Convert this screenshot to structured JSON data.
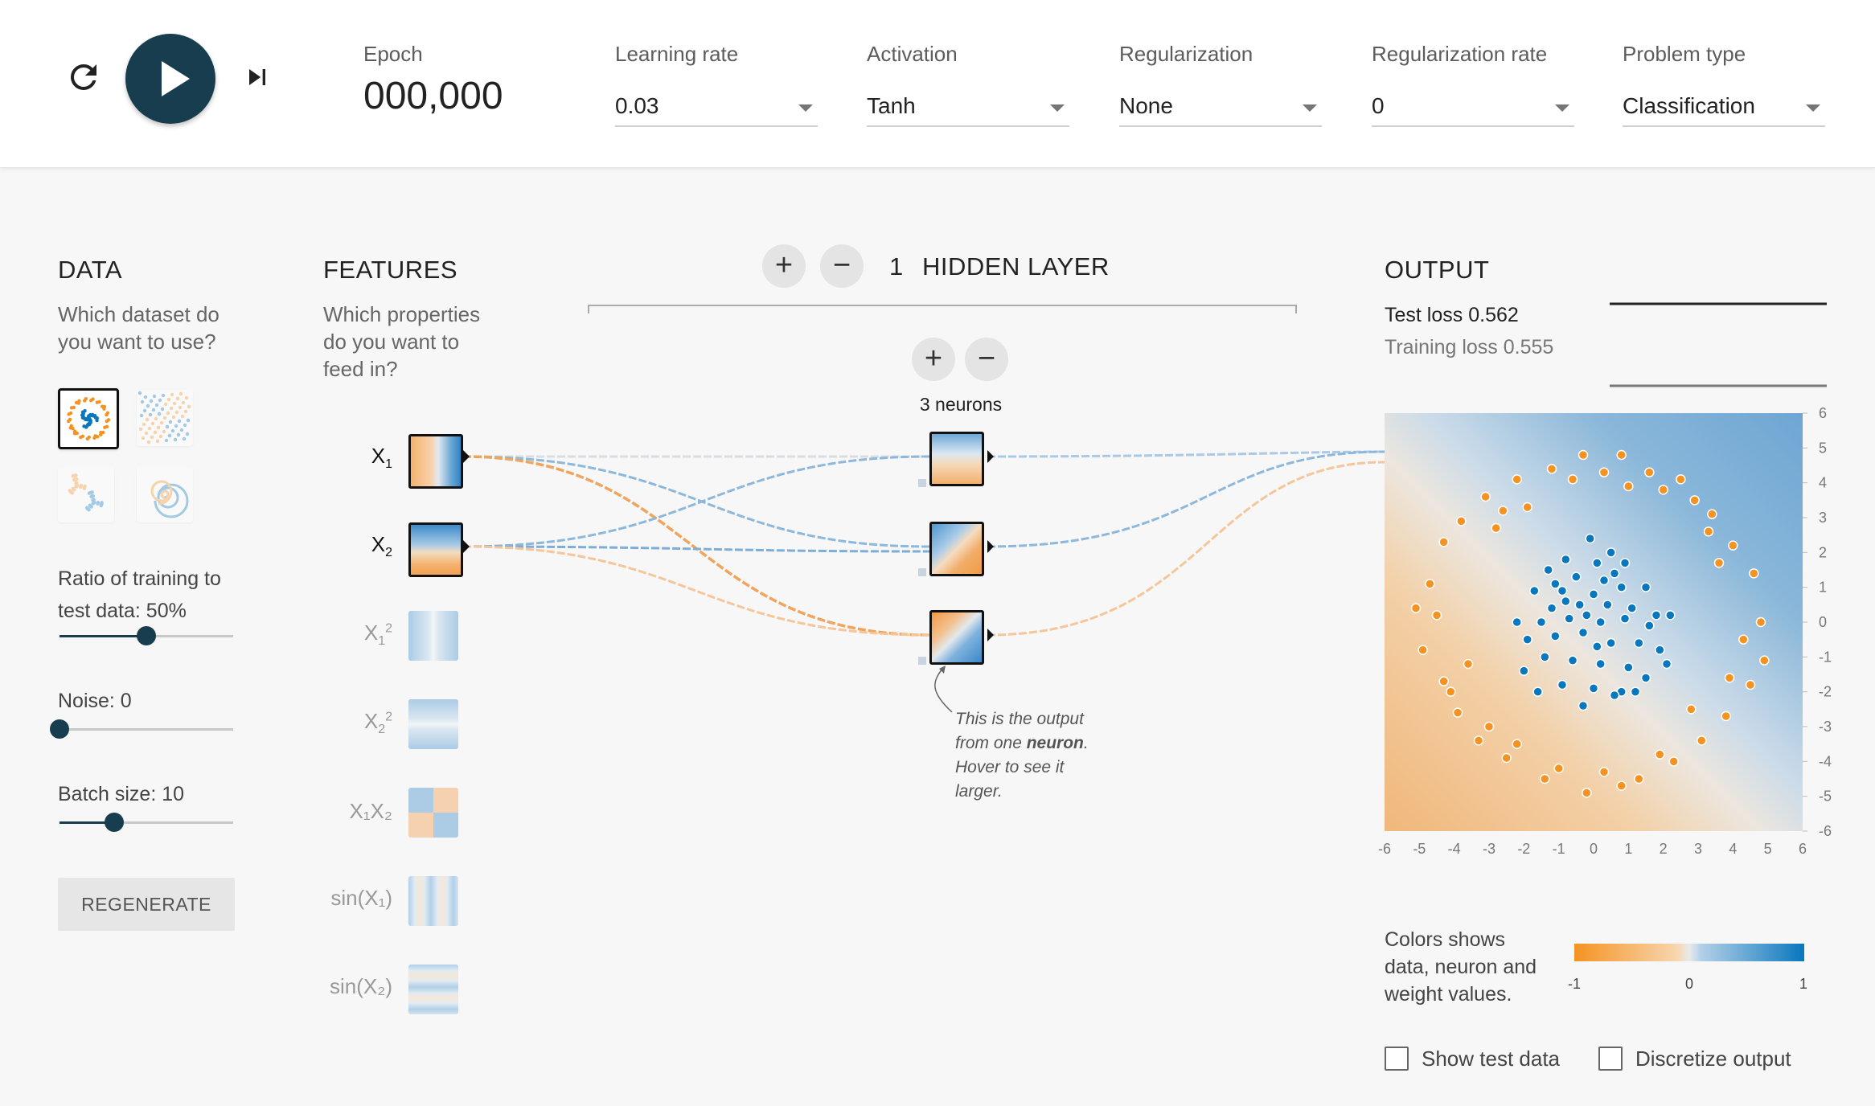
{
  "toolbar": {
    "epoch_label": "Epoch",
    "epoch_value": "000,000",
    "controls": [
      {
        "label": "Learning rate",
        "value": "0.03"
      },
      {
        "label": "Activation",
        "value": "Tanh"
      },
      {
        "label": "Regularization",
        "value": "None"
      },
      {
        "label": "Regularization rate",
        "value": "0"
      },
      {
        "label": "Problem type",
        "value": "Classification"
      }
    ]
  },
  "data_panel": {
    "heading": "DATA",
    "question_line1": "Which dataset do",
    "question_line2": "you want to use?",
    "datasets": [
      "circle",
      "xor",
      "gaussian",
      "spiral"
    ],
    "selected_dataset": "circle",
    "ratio_label_line1": "Ratio of training to",
    "ratio_label_line2": "test data:  50%",
    "ratio_value": 50,
    "noise_label": "Noise:  0",
    "noise_value": 0,
    "batch_label": "Batch size:  10",
    "batch_value": 10,
    "regenerate_label": "REGENERATE"
  },
  "features_panel": {
    "heading": "FEATURES",
    "question_line1": "Which properties",
    "question_line2": "do you want to",
    "question_line3": "feed in?",
    "features": [
      {
        "base": "X",
        "sub": "1",
        "sup": "",
        "active": true
      },
      {
        "base": "X",
        "sub": "2",
        "sup": "",
        "active": true
      },
      {
        "base": "X",
        "sub": "1",
        "sup": "2",
        "active": false
      },
      {
        "base": "X",
        "sub": "2",
        "sup": "2",
        "active": false
      },
      {
        "base": "X₁X₂",
        "sub": "",
        "sup": "",
        "active": false
      },
      {
        "base": "sin(X₁)",
        "sub": "",
        "sup": "",
        "active": false
      },
      {
        "base": "sin(X₂)",
        "sub": "",
        "sup": "",
        "active": false
      }
    ]
  },
  "network": {
    "layer_count": "1",
    "hidden_layer_label": "HIDDEN LAYER",
    "add_symbol": "+",
    "remove_symbol": "−",
    "neurons_label": "3 neurons",
    "note_line1": "This is the output",
    "note_line2_prefix": "from one ",
    "note_line2_bold": "neuron",
    "note_line2_suffix": ".",
    "note_line3": "Hover to see it",
    "note_line4": "larger."
  },
  "output_panel": {
    "heading": "OUTPUT",
    "test_loss_label": "Test loss",
    "test_loss_value": "0.562",
    "training_loss_label": "Training loss",
    "training_loss_value": "0.555",
    "legend_text_line1": "Colors shows",
    "legend_text_line2": "data, neuron and",
    "legend_text_line3": "weight values.",
    "legend_min": "-1",
    "legend_mid": "0",
    "legend_max": "1",
    "show_test_data_label": "Show test data",
    "discretize_label": "Discretize output",
    "colors": {
      "orange": "#f59322",
      "blue": "#0877bd",
      "white": "#e8eaeb"
    }
  },
  "chart_data": {
    "type": "scatter",
    "xlim": [
      -6,
      6
    ],
    "ylim": [
      -6,
      6
    ],
    "x_ticks": [
      "-6",
      "-5",
      "-4",
      "-3",
      "-2",
      "-1",
      "0",
      "1",
      "2",
      "3",
      "4",
      "5",
      "6"
    ],
    "y_ticks": [
      "6",
      "5",
      "4",
      "3",
      "2",
      "1",
      "0",
      "-1",
      "-2",
      "-3",
      "-4",
      "-5",
      "-6"
    ],
    "series": [
      {
        "name": "",
        "color": "#0877bd",
        "points": [
          [
            -0.1,
            2.4
          ],
          [
            0.5,
            2.0
          ],
          [
            -0.8,
            1.8
          ],
          [
            0.1,
            1.7
          ],
          [
            -1.3,
            1.5
          ],
          [
            0.9,
            1.7
          ],
          [
            -0.5,
            1.3
          ],
          [
            0.3,
            1.2
          ],
          [
            -1.7,
            0.9
          ],
          [
            -0.9,
            0.9
          ],
          [
            0.0,
            0.8
          ],
          [
            0.8,
            1.0
          ],
          [
            1.5,
            1.0
          ],
          [
            -1.2,
            0.4
          ],
          [
            -0.4,
            0.5
          ],
          [
            0.4,
            0.5
          ],
          [
            1.1,
            0.4
          ],
          [
            1.8,
            0.2
          ],
          [
            -2.2,
            0.0
          ],
          [
            -1.5,
            0.0
          ],
          [
            -0.7,
            0.1
          ],
          [
            0.2,
            0.0
          ],
          [
            0.9,
            0.1
          ],
          [
            1.6,
            -0.1
          ],
          [
            2.2,
            0.2
          ],
          [
            -1.9,
            -0.5
          ],
          [
            -1.1,
            -0.4
          ],
          [
            -0.3,
            -0.3
          ],
          [
            0.5,
            -0.6
          ],
          [
            1.3,
            -0.6
          ],
          [
            1.9,
            -0.8
          ],
          [
            -1.4,
            -1.0
          ],
          [
            -0.6,
            -1.1
          ],
          [
            0.2,
            -1.2
          ],
          [
            1.0,
            -1.3
          ],
          [
            -2.0,
            -1.4
          ],
          [
            -0.9,
            -1.8
          ],
          [
            0.0,
            -1.9
          ],
          [
            0.8,
            -2.0
          ],
          [
            1.5,
            -1.6
          ],
          [
            -1.6,
            -2.0
          ],
          [
            -0.3,
            -2.4
          ],
          [
            0.6,
            -2.1
          ],
          [
            2.1,
            -1.2
          ],
          [
            -0.8,
            0.6
          ],
          [
            0.1,
            -0.7
          ],
          [
            -0.2,
            0.2
          ],
          [
            0.6,
            1.4
          ],
          [
            -1.1,
            1.1
          ],
          [
            1.2,
            -2.0
          ]
        ]
      },
      {
        "name": "",
        "color": "#f59322",
        "points": [
          [
            -0.3,
            4.8
          ],
          [
            0.8,
            4.8
          ],
          [
            -1.2,
            4.4
          ],
          [
            1.6,
            4.3
          ],
          [
            2.5,
            4.1
          ],
          [
            -2.2,
            4.1
          ],
          [
            -3.1,
            3.6
          ],
          [
            2.9,
            3.5
          ],
          [
            3.4,
            3.1
          ],
          [
            -3.8,
            2.9
          ],
          [
            -4.3,
            2.3
          ],
          [
            4.0,
            2.2
          ],
          [
            4.6,
            1.4
          ],
          [
            -4.7,
            1.1
          ],
          [
            -5.1,
            0.4
          ],
          [
            4.8,
            0.0
          ],
          [
            -4.9,
            -0.8
          ],
          [
            4.9,
            -1.1
          ],
          [
            -4.3,
            -1.7
          ],
          [
            4.5,
            -1.8
          ],
          [
            -3.9,
            -2.6
          ],
          [
            3.8,
            -2.7
          ],
          [
            -3.3,
            -3.4
          ],
          [
            3.1,
            -3.4
          ],
          [
            -2.5,
            -3.9
          ],
          [
            2.3,
            -4.0
          ],
          [
            -1.4,
            -4.5
          ],
          [
            1.3,
            -4.5
          ],
          [
            -0.2,
            -4.9
          ],
          [
            0.8,
            -4.7
          ],
          [
            -2.8,
            2.7
          ],
          [
            2.0,
            3.8
          ],
          [
            -1.9,
            3.3
          ],
          [
            1.0,
            3.9
          ],
          [
            -3.6,
            -1.2
          ],
          [
            3.6,
            1.7
          ],
          [
            -2.2,
            -3.5
          ],
          [
            2.8,
            -2.5
          ],
          [
            -4.5,
            0.2
          ],
          [
            4.3,
            -0.5
          ],
          [
            -1.0,
            -4.2
          ],
          [
            0.3,
            -4.3
          ],
          [
            1.9,
            -3.8
          ],
          [
            -3.0,
            -3.0
          ],
          [
            3.3,
            2.6
          ],
          [
            -0.6,
            4.1
          ],
          [
            0.3,
            4.3
          ],
          [
            -4.1,
            -2.0
          ],
          [
            3.9,
            -1.6
          ],
          [
            -2.6,
            3.2
          ]
        ]
      }
    ]
  }
}
